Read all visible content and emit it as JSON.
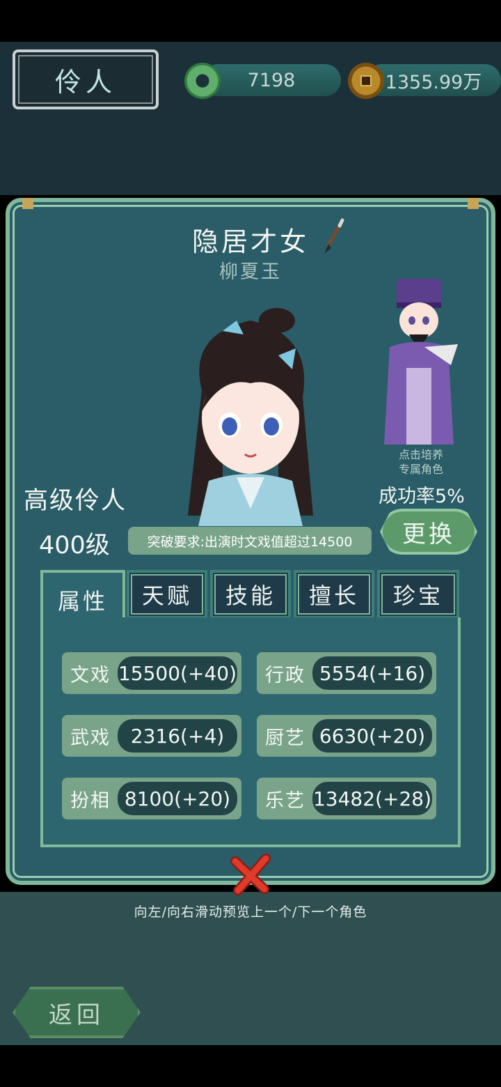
{
  "header": {
    "title": "伶人",
    "jade": "7198",
    "coins": "1355.99万"
  },
  "character": {
    "title": "隐居才女",
    "name": "柳夏玉",
    "rank": "高级伶人",
    "level": "400级",
    "breakthrough": "突破要求:出演时文戏值超过14500",
    "exclusive_note_line1": "点击培养",
    "exclusive_note_line2": "专属角色",
    "success_rate": "成功率5%",
    "swap_label": "更换"
  },
  "tabs": [
    {
      "label": "属性",
      "active": true
    },
    {
      "label": "天赋",
      "active": false
    },
    {
      "label": "技能",
      "active": false
    },
    {
      "label": "擅长",
      "active": false
    },
    {
      "label": "珍宝",
      "active": false
    }
  ],
  "stats": [
    {
      "label": "文戏",
      "value": "15500(+40)"
    },
    {
      "label": "行政",
      "value": "5554(+16)"
    },
    {
      "label": "武戏",
      "value": "2316(+4)"
    },
    {
      "label": "厨艺",
      "value": "6630(+20)"
    },
    {
      "label": "扮相",
      "value": "8100(+20)"
    },
    {
      "label": "乐艺",
      "value": "13482(+28)"
    }
  ],
  "footer": {
    "hint": "向左/向右滑动预览上一个/下一个角色",
    "back_label": "返回"
  },
  "colors": {
    "panel": "#2a5d67",
    "border": "#7fb89b",
    "stat_bg": "#7aa48a",
    "close": "#e03a2a"
  }
}
